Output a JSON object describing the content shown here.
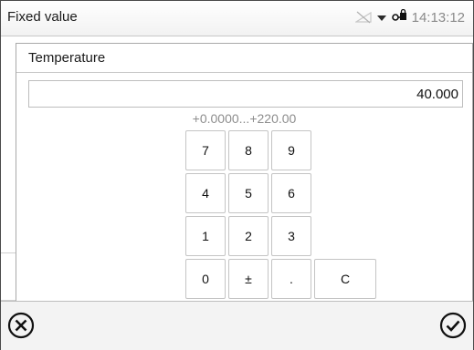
{
  "window": {
    "title": "Fixed value",
    "status": {
      "time": "14:13:12",
      "icons": [
        "network-disconnected-icon",
        "dropdown-arrow-icon",
        "key-lock-icon"
      ]
    }
  },
  "dialog": {
    "title": "Temperature",
    "value": "40.000",
    "range": "+0.0000...+220.00"
  },
  "keypad": {
    "keys": [
      "7",
      "8",
      "9",
      "4",
      "5",
      "6",
      "1",
      "2",
      "3",
      "0",
      "±",
      ".",
      "C"
    ]
  },
  "footer": {
    "icons": [
      "cancel-icon",
      "confirm-icon"
    ]
  }
}
